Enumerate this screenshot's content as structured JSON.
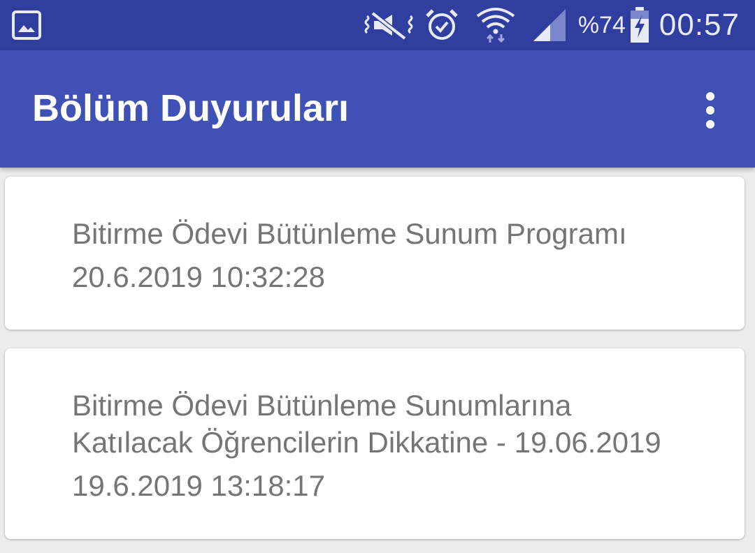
{
  "status_bar": {
    "icons": [
      "gallery-icon",
      "vibrate-icon",
      "alarm-icon",
      "wifi-icon",
      "signal-icon",
      "battery-charging-icon"
    ],
    "battery_percent": "%74",
    "time": "00:57",
    "background": "#303f9f"
  },
  "app_bar": {
    "title": "Bölüm Duyuruları",
    "menu_icon": "more-vert-icon",
    "background": "#3f51b5"
  },
  "announcements": [
    {
      "title": "Bitirme Ödevi Bütünleme Sunum Programı",
      "date": "20.6.2019 10:32:28"
    },
    {
      "title_line1": "Bitirme Ödevi Bütünleme Sunumlarına",
      "title_line2": "Katılacak Öğrencilerin Dikkatine - 19.06.2019",
      "date": "19.6.2019 13:18:17"
    }
  ],
  "colors": {
    "text_secondary": "#757575",
    "list_background": "#ececec",
    "card_background": "#ffffff"
  }
}
